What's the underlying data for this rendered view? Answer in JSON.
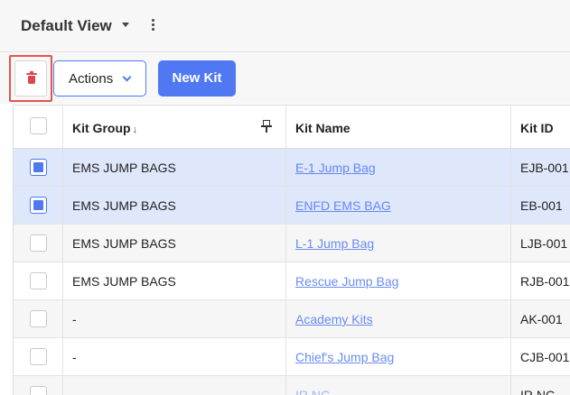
{
  "view": {
    "title": "Default View"
  },
  "toolbar": {
    "actions_label": "Actions",
    "new_kit_label": "New Kit"
  },
  "grid": {
    "columns": {
      "kit_group": "Kit Group",
      "kit_group_sort": "↓",
      "kit_name": "Kit Name",
      "kit_id": "Kit ID"
    },
    "rows": [
      {
        "selected": true,
        "kit_group": "EMS JUMP BAGS",
        "kit_name": "E-1 Jump Bag",
        "kit_id": "EJB-001"
      },
      {
        "selected": true,
        "kit_group": "EMS JUMP BAGS",
        "kit_name": "ENFD EMS BAG",
        "kit_id": "EB-001"
      },
      {
        "selected": false,
        "kit_group": "EMS JUMP BAGS",
        "kit_name": "L-1 Jump Bag",
        "kit_id": "LJB-001"
      },
      {
        "selected": false,
        "kit_group": "EMS JUMP BAGS",
        "kit_name": "Rescue Jump Bag",
        "kit_id": "RJB-001"
      },
      {
        "selected": false,
        "kit_group": "-",
        "kit_name": "Academy Kits",
        "kit_id": "AK-001"
      },
      {
        "selected": false,
        "kit_group": "-",
        "kit_name": "Chief's Jump Bag",
        "kit_id": "CJB-001"
      },
      {
        "selected": false,
        "kit_group": "",
        "kit_name": "IR NC",
        "kit_id": "IR NC"
      }
    ]
  },
  "colors": {
    "accent": "#4f78f2",
    "selected_row": "#dfe7fb",
    "delete_red": "#d9474f",
    "highlight_border": "#e35454"
  }
}
